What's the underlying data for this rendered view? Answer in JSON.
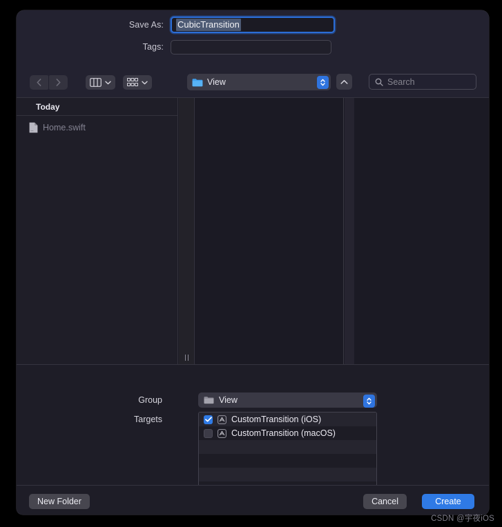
{
  "dialog": {
    "save_as_label": "Save As:",
    "save_as_value": "CubicTransition",
    "tags_label": "Tags:",
    "tags_value": ""
  },
  "toolbar": {
    "back_icon": "chevron-left-icon",
    "forward_icon": "chevron-right-icon",
    "view_mode_icon": "column-view-icon",
    "group_mode_icon": "gallery-view-icon",
    "path_folder_icon": "folder-icon",
    "path_label": "View",
    "up_icon": "chevron-up-icon",
    "search_placeholder": "Search",
    "search_value": "",
    "search_icon": "search-icon"
  },
  "browser": {
    "section_header": "Today",
    "files": [
      {
        "name": "Home.swift",
        "icon": "document-icon"
      }
    ]
  },
  "accessory": {
    "group_label": "Group",
    "group_value": "View",
    "group_folder_icon": "folder-icon",
    "targets_label": "Targets",
    "targets": [
      {
        "name": "CustomTransition (iOS)",
        "checked": true,
        "icon": "app-target-icon"
      },
      {
        "name": "CustomTransition (macOS)",
        "checked": false,
        "icon": "app-target-icon"
      }
    ]
  },
  "footer": {
    "new_folder_label": "New Folder",
    "cancel_label": "Cancel",
    "create_label": "Create"
  },
  "watermark": {
    "text": "CSDN @宇夜iOS"
  },
  "colors": {
    "accent": "#2f7ae5",
    "dialog_bg": "#1e1d26",
    "header_bg": "#232230",
    "folder_blue": "#3fa0ee"
  }
}
